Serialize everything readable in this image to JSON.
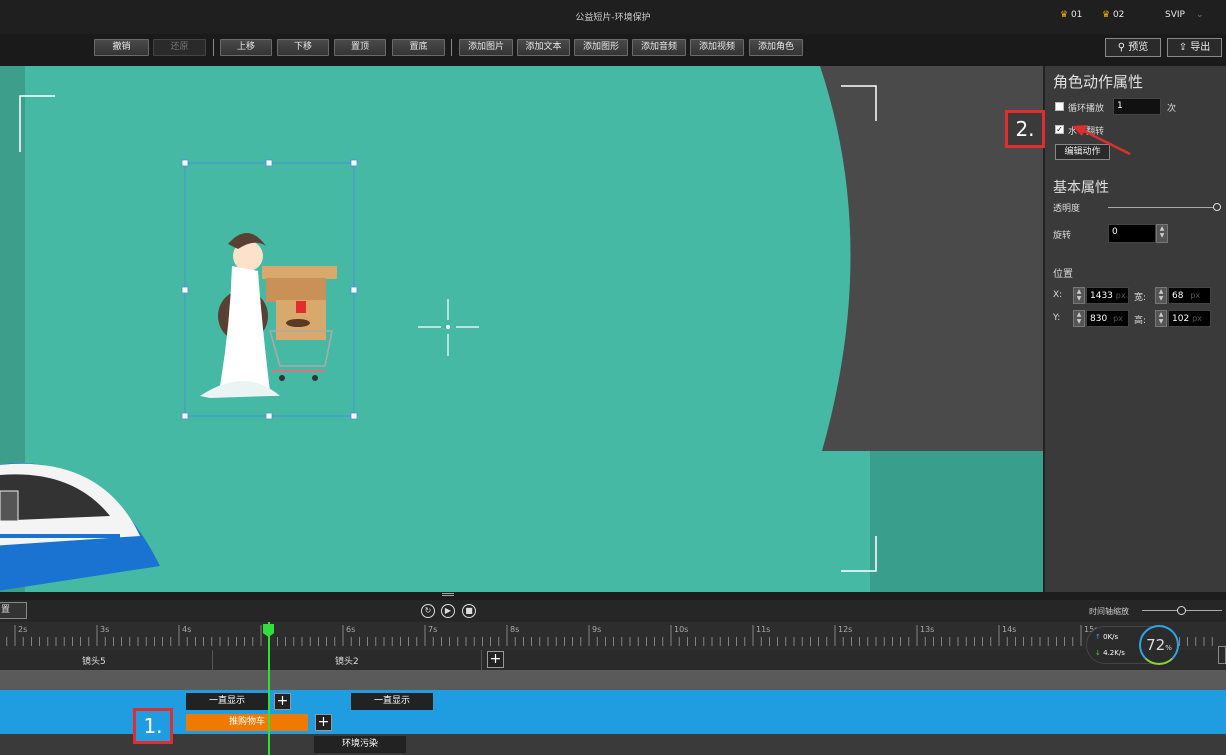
{
  "window": {
    "title": "公益短片-环境保护",
    "badge1": "01",
    "badge2": "02",
    "vip": "SVIP"
  },
  "toolbar": {
    "undo": "撤销",
    "redo": "还原",
    "move_up": "上移",
    "move_down": "下移",
    "to_top": "置顶",
    "to_bottom": "置底",
    "add_image": "添加图片",
    "add_text": "添加文本",
    "add_shape": "添加图形",
    "add_audio": "添加音频",
    "add_video": "添加视频",
    "add_role": "添加角色",
    "preview": "预览",
    "export": "导出"
  },
  "panel": {
    "role_action_title": "角色动作属性",
    "loop_play": "循环播放",
    "loop_count": "1",
    "loop_unit": "次",
    "horizontal_flip": "水平翻转",
    "horizontal_flip_checked": true,
    "edit_action": "编辑动作",
    "basic_title": "基本属性",
    "opacity_label": "透明度",
    "opacity_value": 1.0,
    "rotate_label": "旋转",
    "rotate_value": "0",
    "position_title": "位置",
    "x_label": "X:",
    "x_value": "1433",
    "y_label": "Y:",
    "y_value": "830",
    "width_label": "宽:",
    "width_value": "68",
    "height_label": "高:",
    "height_value": "102",
    "unit": "px"
  },
  "annotations": {
    "step1": "1.",
    "step2": "2."
  },
  "timeline": {
    "left_button": "置",
    "zoom_label": "时间轴缩放",
    "ticks": [
      "2s",
      "3s",
      "4s",
      "5s",
      "6s",
      "7s",
      "8s",
      "9s",
      "10s",
      "11s",
      "12s",
      "13s",
      "14s",
      "15s"
    ],
    "shot_a": "镜头5",
    "shot_b": "镜头2",
    "always_show_1": "一直显示",
    "always_show_2": "一直显示",
    "clip_cart": "推购物车",
    "clip_env": "环境污染"
  },
  "network": {
    "upload": "0K/s",
    "download": "4.2K/s",
    "percent": "72",
    "percent_unit": "%"
  },
  "colors": {
    "canvas_bg": "#46b9a4",
    "timeline_blue": "#1f9de0",
    "clip_orange": "#f07a00",
    "annotation_red": "#e02d2d",
    "playhead_green": "#2ee03a"
  }
}
